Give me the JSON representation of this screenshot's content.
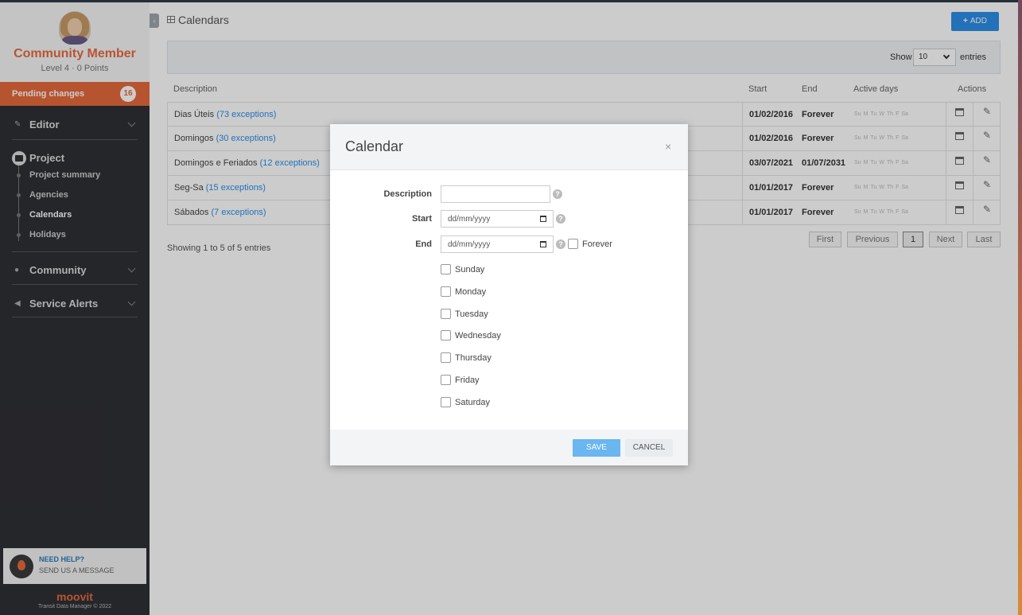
{
  "sidebar": {
    "profile": {
      "name": "Community Member",
      "level": "Level 4 · 0 Points"
    },
    "pending": {
      "label": "Pending changes",
      "count": "16"
    },
    "nav": {
      "editor": "Editor",
      "project": "Project",
      "project_items": [
        "Project summary",
        "Agencies",
        "Calendars",
        "Holidays"
      ],
      "community": "Community",
      "service_alerts": "Service Alerts"
    },
    "help": {
      "title": "NEED HELP?",
      "subtitle": "SEND US A MESSAGE"
    },
    "brand": "moovit",
    "copyright": "Transit Data Manager © 2022"
  },
  "main": {
    "title": "Calendars",
    "add_label": "ADD",
    "show_label": "Show",
    "show_value": "10",
    "entries_label": "entries",
    "headers": {
      "description": "Description",
      "start": "Start",
      "end": "End",
      "active_days": "Active days",
      "actions": "Actions"
    },
    "day_abbr": [
      "Su",
      "M",
      "Tu",
      "W",
      "Th",
      "F",
      "Sa"
    ],
    "rows": [
      {
        "name": "Dias Úteis",
        "exceptions": "(73 exceptions)",
        "start": "01/02/2016",
        "end": "Forever"
      },
      {
        "name": "Domingos",
        "exceptions": "(30 exceptions)",
        "start": "01/02/2016",
        "end": "Forever"
      },
      {
        "name": "Domingos e Feriados",
        "exceptions": "(12 exceptions)",
        "start": "03/07/2021",
        "end": "01/07/2031"
      },
      {
        "name": "Seg-Sa",
        "exceptions": "(15 exceptions)",
        "start": "01/01/2017",
        "end": "Forever"
      },
      {
        "name": "Sábados",
        "exceptions": "(7 exceptions)",
        "start": "01/01/2017",
        "end": "Forever"
      }
    ],
    "showing": "Showing 1 to 5 of 5 entries",
    "pagination": {
      "first": "First",
      "previous": "Previous",
      "page": "1",
      "next": "Next",
      "last": "Last"
    }
  },
  "modal": {
    "title": "Calendar",
    "close": "×",
    "description_label": "Description",
    "description_value": "",
    "start_label": "Start",
    "start_placeholder": "dd/mm/yyyy",
    "end_label": "End",
    "end_placeholder": "dd/mm/yyyy",
    "forever_label": "Forever",
    "help": "?",
    "days": [
      "Sunday",
      "Monday",
      "Tuesday",
      "Wednesday",
      "Thursday",
      "Friday",
      "Saturday"
    ],
    "save_label": "SAVE",
    "cancel_label": "CANCEL"
  }
}
